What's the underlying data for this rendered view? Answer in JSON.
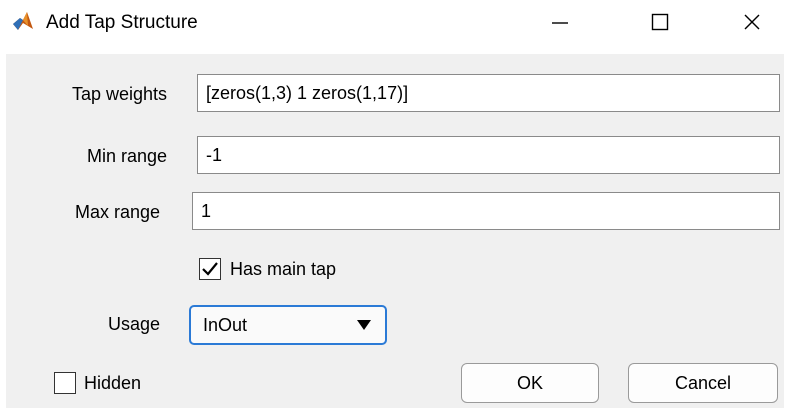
{
  "window": {
    "title": "Add Tap Structure"
  },
  "form": {
    "tap_weights": {
      "label": "Tap weights",
      "value": "[zeros(1,3) 1 zeros(1,17)]"
    },
    "min_range": {
      "label": "Min range",
      "value": "-1"
    },
    "max_range": {
      "label": "Max range",
      "value": "1"
    },
    "has_main_tap": {
      "label": "Has main tap",
      "checked": true
    },
    "usage": {
      "label": "Usage",
      "selected": "InOut"
    },
    "hidden": {
      "label": "Hidden",
      "checked": false
    }
  },
  "buttons": {
    "ok": "OK",
    "cancel": "Cancel"
  },
  "icons": {
    "app": "matlab-icon",
    "minimize": "minimize-icon",
    "maximize": "maximize-icon",
    "close": "close-icon",
    "dropdown": "triangle-down-icon",
    "check": "checkmark-icon"
  },
  "colors": {
    "focus_border": "#2b7ad6",
    "panel_bg": "#f0f0f0"
  }
}
